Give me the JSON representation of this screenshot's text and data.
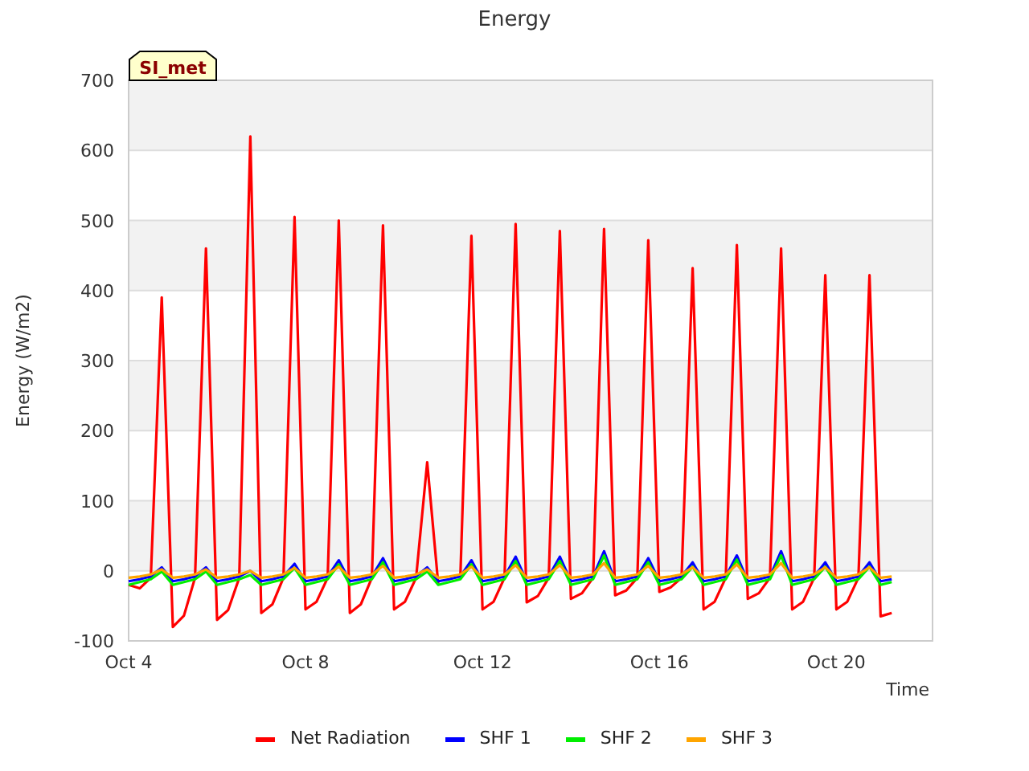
{
  "chart": {
    "badge": "SI_met",
    "chart_data": {
      "type": "line",
      "title": "Energy",
      "xlabel": "Time",
      "ylabel": "Energy (W/m2)",
      "categories": [
        "Oct 4",
        null,
        null,
        null,
        null,
        null,
        null,
        null,
        null,
        null,
        null,
        null,
        null,
        null,
        null,
        null,
        "Oct 8",
        null,
        null,
        null,
        null,
        null,
        null,
        null,
        null,
        null,
        null,
        null,
        null,
        null,
        null,
        null,
        "Oct 12",
        null,
        null,
        null,
        null,
        null,
        null,
        null,
        null,
        null,
        null,
        null,
        null,
        null,
        null,
        null,
        "Oct 16",
        null,
        null,
        null,
        null,
        null,
        null,
        null,
        null,
        null,
        null,
        null,
        null,
        null,
        null,
        null,
        "Oct 20",
        null,
        null,
        null,
        null,
        null
      ],
      "series": [
        {
          "name": "Net Radiation",
          "color": "#ff0000",
          "values": [
            -20,
            -25,
            -10,
            390,
            -80,
            -64,
            -10,
            460,
            -70,
            -56,
            -10,
            620,
            -60,
            -48,
            -10,
            505,
            -55,
            -44,
            -10,
            500,
            -60,
            -48,
            -10,
            493,
            -55,
            -44,
            -10,
            155,
            -20,
            null,
            -10,
            478,
            -55,
            -44,
            -10,
            495,
            -45,
            -36,
            -10,
            485,
            -40,
            -32,
            -10,
            488,
            -35,
            -28,
            -10,
            472,
            -30,
            -24,
            -10,
            432,
            -55,
            -44,
            -10,
            465,
            -40,
            -32,
            -10,
            460,
            -55,
            -44,
            -10,
            422,
            -55,
            -44,
            -10,
            422,
            -65,
            -60
          ]
        },
        {
          "name": "SHF 1",
          "color": "#0000ff",
          "values": [
            -15,
            -12,
            -8,
            5,
            -15,
            -12,
            -8,
            5,
            -15,
            -12,
            -8,
            0,
            -15,
            -12,
            -8,
            10,
            -15,
            -12,
            -8,
            15,
            -15,
            -12,
            -8,
            18,
            -15,
            -12,
            -8,
            5,
            -15,
            -12,
            -8,
            15,
            -15,
            -12,
            -8,
            20,
            -15,
            -12,
            -8,
            20,
            -15,
            -12,
            -8,
            28,
            -15,
            -12,
            -8,
            18,
            -15,
            -12,
            -8,
            12,
            -15,
            -12,
            -8,
            22,
            -15,
            -12,
            -8,
            28,
            -15,
            -12,
            -8,
            12,
            -15,
            -12,
            -8,
            12,
            -15,
            -12
          ]
        },
        {
          "name": "SHF 2",
          "color": "#00ee00",
          "values": [
            -20,
            -16,
            -12,
            -1,
            -20,
            -16,
            -12,
            -1,
            -20,
            -16,
            -12,
            -6,
            -20,
            -16,
            -12,
            4,
            -20,
            -16,
            -12,
            9,
            -20,
            -16,
            -12,
            12,
            -20,
            -16,
            -12,
            -1,
            -20,
            -16,
            -12,
            9,
            -20,
            -16,
            -12,
            14,
            -20,
            -16,
            -12,
            14,
            -20,
            -16,
            -12,
            22,
            -20,
            -16,
            -12,
            12,
            -20,
            -16,
            -12,
            6,
            -20,
            -16,
            -12,
            16,
            -20,
            -16,
            -12,
            22,
            -20,
            -16,
            -12,
            6,
            -20,
            -16,
            -12,
            6,
            -20,
            -16
          ]
        },
        {
          "name": "SHF 3",
          "color": "#ffa500",
          "values": [
            -10,
            -8,
            -5,
            2,
            -10,
            -8,
            -5,
            2,
            -10,
            -8,
            -5,
            0,
            -10,
            -8,
            -5,
            4,
            -10,
            -8,
            -5,
            6,
            -10,
            -8,
            -5,
            7,
            -10,
            -8,
            -5,
            2,
            -10,
            -8,
            -5,
            6,
            -10,
            -8,
            -5,
            8,
            -10,
            -8,
            -5,
            8,
            -10,
            -8,
            -5,
            11,
            -10,
            -8,
            -5,
            7,
            -10,
            -8,
            -5,
            5,
            -10,
            -8,
            -5,
            9,
            -10,
            -8,
            -5,
            11,
            -10,
            -8,
            -5,
            5,
            -10,
            -8,
            -5,
            5,
            -10,
            -8
          ]
        }
      ],
      "grid": true,
      "bands": [
        {
          "axis": "y",
          "from": 0,
          "to": 100
        },
        {
          "axis": "y",
          "from": 200,
          "to": 300
        },
        {
          "axis": "y",
          "from": 400,
          "to": 500
        },
        {
          "axis": "y",
          "from": 600,
          "to": 700
        }
      ],
      "ylim": [
        -100,
        700
      ],
      "yticks": [
        -100,
        0,
        100,
        200,
        300,
        400,
        500,
        600,
        700
      ]
    }
  }
}
